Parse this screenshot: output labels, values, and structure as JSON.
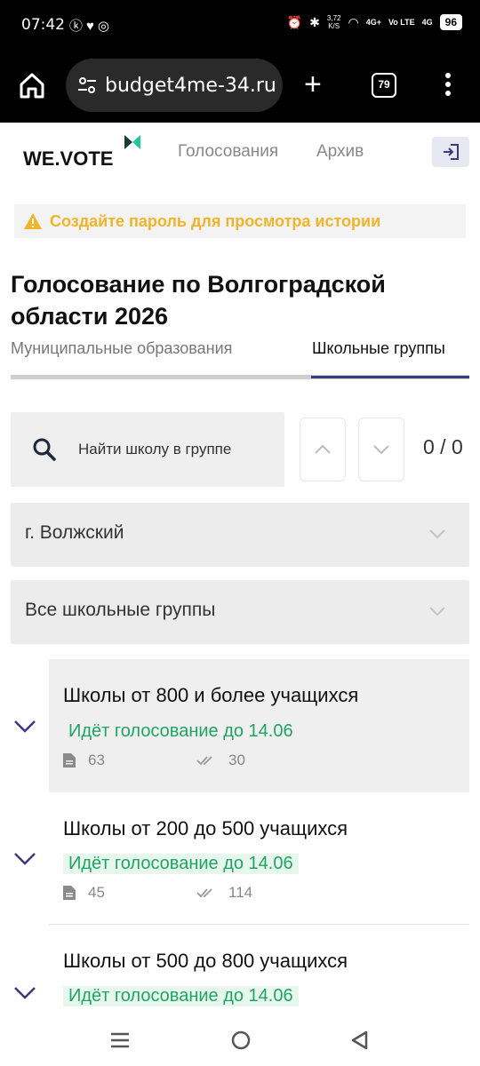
{
  "status_bar": {
    "time": "07:42",
    "net_speed_value": "3,72",
    "net_speed_unit": "K/S",
    "net1": "4G+",
    "volte": "Vo LTE",
    "net2": "4G",
    "battery": "96"
  },
  "browser": {
    "url": "budget4me-34.ru",
    "tab_count": "79"
  },
  "header": {
    "logo": "WE.VOTE",
    "nav_votes": "Голосования",
    "nav_archive": "Архив"
  },
  "notice": {
    "text": "Создайте пароль для просмотра истории"
  },
  "page": {
    "title": "Голосование по Волгоградской области 2026"
  },
  "tabs": {
    "municipal": "Муниципальные образования",
    "school_groups": "Школьные группы"
  },
  "search": {
    "placeholder": "Найти школу в группе",
    "match_count": "0 / 0"
  },
  "filters": {
    "city": "г. Волжский",
    "group": "Все школьные группы"
  },
  "groups": [
    {
      "title": "Школы от 800 и более учащихся",
      "status": "Идёт голосование до 14.06",
      "docs": "63",
      "votes": "30"
    },
    {
      "title": "Школы от 200 до 500 учащихся",
      "status": "Идёт голосование до 14.06",
      "docs": "45",
      "votes": "114"
    },
    {
      "title": "Школы от 500 до 800 учащихся",
      "status": "Идёт голосование до 14.06"
    }
  ],
  "colors": {
    "accent": "#3b3a7a",
    "status_green": "#1fa463",
    "warning": "#f0b429"
  }
}
